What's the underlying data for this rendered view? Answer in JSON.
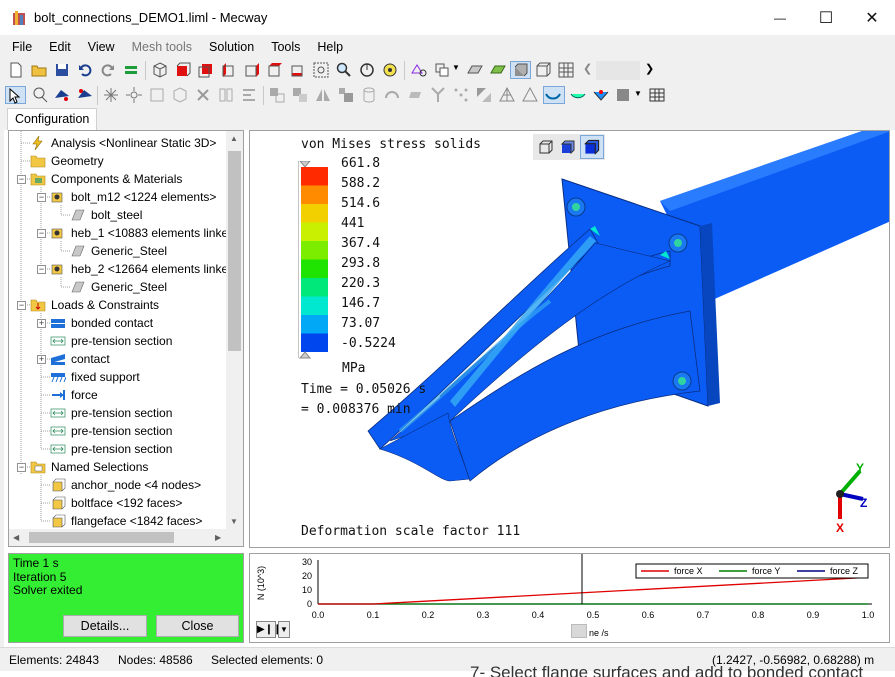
{
  "window": {
    "title": "bolt_connections_DEMO1.liml - Mecway",
    "minimize_glyph": "—",
    "maximize_glyph": "☐",
    "close_glyph": "✕"
  },
  "menu": {
    "items": [
      {
        "label": "File",
        "enabled": true
      },
      {
        "label": "Edit",
        "enabled": true
      },
      {
        "label": "View",
        "enabled": true
      },
      {
        "label": "Mesh tools",
        "enabled": false
      },
      {
        "label": "Solution",
        "enabled": true
      },
      {
        "label": "Tools",
        "enabled": true
      },
      {
        "label": "Help",
        "enabled": true
      }
    ]
  },
  "tabs": {
    "configuration": "Configuration"
  },
  "tree": {
    "items": [
      {
        "label": "Analysis <Nonlinear Static 3D>",
        "icon": "analysis-icon"
      },
      {
        "label": "Geometry",
        "icon": "folder-icon"
      },
      {
        "label": "Components & Materials",
        "icon": "components-icon"
      },
      {
        "label": "bolt_m12 <1224 elements>",
        "icon": "component-icon"
      },
      {
        "label": "bolt_steel",
        "icon": "material-icon"
      },
      {
        "label": "heb_1 <10883 elements linke",
        "icon": "component-icon"
      },
      {
        "label": "Generic_Steel",
        "icon": "material-icon"
      },
      {
        "label": "heb_2 <12664 elements linke",
        "icon": "component-icon"
      },
      {
        "label": "Generic_Steel",
        "icon": "material-icon"
      },
      {
        "label": "Loads & Constraints",
        "icon": "loads-folder-icon"
      },
      {
        "label": "bonded contact",
        "icon": "bonded-contact-icon"
      },
      {
        "label": "pre-tension section",
        "icon": "pretension-icon"
      },
      {
        "label": "contact",
        "icon": "contact-icon"
      },
      {
        "label": "fixed support",
        "icon": "fixed-support-icon"
      },
      {
        "label": "force",
        "icon": "force-icon"
      },
      {
        "label": "pre-tension section",
        "icon": "pretension-icon"
      },
      {
        "label": "pre-tension section",
        "icon": "pretension-icon"
      },
      {
        "label": "pre-tension section",
        "icon": "pretension-icon"
      },
      {
        "label": "Named Selections",
        "icon": "named-folder-icon"
      },
      {
        "label": "anchor_node <4 nodes>",
        "icon": "selection-icon"
      },
      {
        "label": "boltface <192 faces>",
        "icon": "selection-icon"
      },
      {
        "label": "flangeface <1842 faces>",
        "icon": "selection-icon"
      }
    ],
    "expander_plus": "+",
    "expander_minus": "−"
  },
  "legend": {
    "title": "von Mises stress solids",
    "values": [
      "661.8",
      "588.2",
      "514.6",
      "441",
      "367.4",
      "293.8",
      "220.3",
      "146.7",
      "73.07",
      "-0.5224"
    ],
    "colors": [
      "#ff2a00",
      "#ff8c00",
      "#f2d000",
      "#c8f000",
      "#7ded00",
      "#1fe300",
      "#00e87a",
      "#00e8cf",
      "#00a8f5",
      "#0046ef"
    ],
    "unit": "MPa",
    "time_s": "Time = 0.05026 s",
    "time_min": "= 0.008376 min",
    "deformation": "Deformation scale factor 111"
  },
  "triad": {
    "x": "X",
    "y": "Y",
    "z": "Z"
  },
  "status": {
    "lines": [
      "Time 1 s",
      "Iteration 5",
      "Solver exited"
    ],
    "details_button": "Details...",
    "close_button": "Close"
  },
  "chart_data": {
    "type": "line",
    "title": "",
    "xlabel": "ne /s",
    "ylabel": "N (10^3)",
    "xlim": [
      0.0,
      1.0
    ],
    "ylim": [
      0,
      30
    ],
    "x_ticks": [
      "0.0",
      "0.1",
      "0.2",
      "0.3",
      "0.4",
      "0.5",
      "0.6",
      "0.7",
      "0.8",
      "0.9",
      "1.0"
    ],
    "y_ticks": [
      "30",
      "20",
      "10",
      "0"
    ],
    "cursor_x": 0.48,
    "legend_position": "top-right",
    "series": [
      {
        "name": "force X",
        "color": "#e00000",
        "x": [
          0.0,
          0.1,
          1.0
        ],
        "y": [
          0,
          0,
          19
        ]
      },
      {
        "name": "force Y",
        "color": "#008000",
        "x": [
          0.0,
          1.0
        ],
        "y": [
          0,
          0
        ]
      },
      {
        "name": "force Z",
        "color": "#00007f",
        "x": [
          0.0,
          1.0
        ],
        "y": [
          0,
          0
        ]
      }
    ]
  },
  "statusbar": {
    "elements": "Elements: 24843",
    "nodes": "Nodes: 48586",
    "selected": "Selected elements: 0",
    "coords": "(1.2427, -0.56982, 0.68288) m"
  },
  "background_doc_text": "7- Select flange surfaces and add to bonded contact",
  "colors": {
    "model_blue": "#0a5cf5",
    "model_light": "#35a8f5",
    "status_green": "#33ee33"
  }
}
